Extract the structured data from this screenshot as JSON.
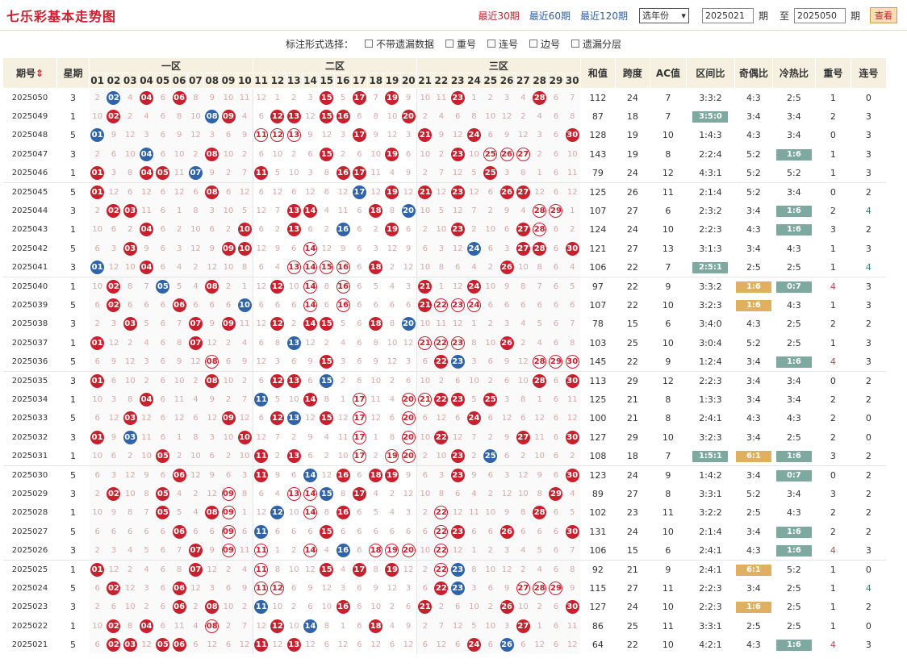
{
  "title": "七乐彩基本走势图",
  "periods": [
    "最近30期",
    "最近60期",
    "最近120期"
  ],
  "year_select": "选年份",
  "from_value": "2025021",
  "from_unit": "期",
  "to_label": "至",
  "to_value": "2025050",
  "to_unit": "期",
  "query_btn": "查看",
  "options_label": "标注形式选择：",
  "options": [
    "不带遗漏数据",
    "重号",
    "连号",
    "边号",
    "遗漏分层"
  ],
  "headers": {
    "period": "期号",
    "week": "星期",
    "zone1": "一区",
    "zone2": "二区",
    "zone3": "三区",
    "sum": "和值",
    "span": "跨度",
    "ac": "AC值",
    "zone_ratio": "区间比",
    "odd_even": "奇偶比",
    "hot_cold": "冷热比",
    "repeat": "重号",
    "consec": "连号"
  },
  "nums": [
    "01",
    "02",
    "03",
    "04",
    "05",
    "06",
    "07",
    "08",
    "09",
    "10",
    "11",
    "12",
    "13",
    "14",
    "15",
    "16",
    "17",
    "18",
    "19",
    "20",
    "21",
    "22",
    "23",
    "24",
    "25",
    "26",
    "27",
    "28",
    "29",
    "30"
  ],
  "rows": [
    {
      "p": "2025050",
      "w": "3",
      "r": [
        4,
        6,
        15,
        17,
        19,
        23,
        28
      ],
      "b": [
        2
      ],
      "sum": "112",
      "span": "24",
      "ac": "7",
      "zr": "3:3:2",
      "oe": "4:3",
      "hc": "2:5",
      "rep": "1",
      "con": "0"
    },
    {
      "p": "2025049",
      "w": "1",
      "r": [
        2,
        9,
        12,
        13,
        15,
        16,
        20
      ],
      "b": [
        8
      ],
      "sum": "87",
      "span": "18",
      "ac": "7",
      "zr": "3:5:0",
      "zrT": "g",
      "oe": "3:4",
      "hc": "3:4",
      "rep": "2",
      "con": "3"
    },
    {
      "p": "2025048",
      "w": "5",
      "r": [
        17,
        21,
        24,
        30
      ],
      "b": [
        1
      ],
      "o": [
        11,
        12,
        13
      ],
      "sum": "128",
      "span": "19",
      "ac": "10",
      "zr": "1:4:3",
      "oe": "4:3",
      "hc": "3:4",
      "rep": "0",
      "con": "3"
    },
    {
      "p": "2025047",
      "w": "3",
      "r": [
        8,
        15,
        19,
        23
      ],
      "b": [
        4
      ],
      "o": [
        25,
        26,
        27
      ],
      "sum": "143",
      "span": "19",
      "ac": "8",
      "zr": "2:2:4",
      "oe": "5:2",
      "hc": "1:6",
      "hcT": "g",
      "rep": "1",
      "con": "3"
    },
    {
      "p": "2025046",
      "w": "1",
      "r": [
        1,
        4,
        5,
        11,
        16,
        17,
        25
      ],
      "b": [
        7
      ],
      "sum": "79",
      "span": "24",
      "ac": "12",
      "zr": "4:3:1",
      "oe": "5:2",
      "hc": "5:2",
      "rep": "1",
      "con": "3"
    },
    {
      "p": "2025045",
      "w": "5",
      "r": [
        1,
        8,
        19,
        21,
        23,
        26,
        27
      ],
      "b": [
        17
      ],
      "sum": "125",
      "span": "26",
      "ac": "11",
      "zr": "2:1:4",
      "oe": "5:2",
      "hc": "3:4",
      "rep": "0",
      "con": "2"
    },
    {
      "p": "2025044",
      "w": "3",
      "r": [
        2,
        3,
        13,
        14,
        18
      ],
      "b": [
        20
      ],
      "o": [
        28,
        29
      ],
      "sum": "107",
      "span": "27",
      "ac": "6",
      "zr": "2:3:2",
      "oe": "3:4",
      "hc": "1:6",
      "hcT": "g",
      "rep": "2",
      "con": "4",
      "conC": 1
    },
    {
      "p": "2025043",
      "w": "1",
      "r": [
        4,
        10,
        13,
        19,
        23,
        27
      ],
      "b": [
        16
      ],
      "o": [
        28
      ],
      "sum": "124",
      "span": "24",
      "ac": "10",
      "zr": "2:2:3",
      "oe": "4:3",
      "hc": "1:6",
      "hcT": "g",
      "rep": "3",
      "con": "2"
    },
    {
      "p": "2025042",
      "w": "5",
      "r": [
        3,
        9,
        10,
        27,
        28,
        30
      ],
      "b": [
        24
      ],
      "o": [
        14
      ],
      "sum": "121",
      "span": "27",
      "ac": "13",
      "zr": "3:1:3",
      "oe": "3:4",
      "hc": "4:3",
      "rep": "1",
      "con": "3"
    },
    {
      "p": "2025041",
      "w": "3",
      "r": [
        4,
        18,
        26
      ],
      "b": [
        1
      ],
      "o": [
        13,
        14,
        15,
        16
      ],
      "sum": "106",
      "span": "22",
      "ac": "7",
      "zr": "2:5:1",
      "zrT": "g",
      "oe": "2:5",
      "hc": "2:5",
      "rep": "1",
      "con": "4",
      "conC": 1
    },
    {
      "p": "2025040",
      "w": "1",
      "r": [
        2,
        8,
        12,
        21,
        24
      ],
      "b": [
        5
      ],
      "o": [
        14,
        16
      ],
      "sum": "97",
      "span": "22",
      "ac": "9",
      "zr": "3:3:2",
      "oe": "1:6",
      "oeT": "y",
      "hc": "0:7",
      "hcT": "g",
      "rep": "4",
      "repC": 1,
      "con": "3"
    },
    {
      "p": "2025039",
      "w": "5",
      "r": [
        2,
        6,
        21
      ],
      "b": [
        10
      ],
      "o": [
        14,
        16,
        22,
        23,
        24
      ],
      "sum": "107",
      "span": "22",
      "ac": "10",
      "zr": "3:2:3",
      "oe": "1:6",
      "oeT": "y",
      "hc": "4:3",
      "rep": "1",
      "con": "3"
    },
    {
      "p": "2025038",
      "w": "3",
      "r": [
        3,
        7,
        9,
        12,
        14,
        15,
        18
      ],
      "b": [
        20
      ],
      "sum": "78",
      "span": "15",
      "ac": "6",
      "zr": "3:4:0",
      "oe": "4:3",
      "hc": "2:5",
      "rep": "2",
      "con": "2"
    },
    {
      "p": "2025037",
      "w": "1",
      "r": [
        1,
        7,
        26
      ],
      "b": [
        13
      ],
      "o": [
        21,
        22,
        23
      ],
      "sum": "103",
      "span": "25",
      "ac": "10",
      "zr": "3:0:4",
      "oe": "5:2",
      "hc": "2:5",
      "rep": "1",
      "con": "3"
    },
    {
      "p": "2025036",
      "w": "5",
      "r": [
        15,
        22
      ],
      "b": [
        23
      ],
      "o": [
        8,
        28,
        29,
        30
      ],
      "sum": "145",
      "span": "22",
      "ac": "9",
      "zr": "1:2:4",
      "oe": "3:4",
      "hc": "1:6",
      "hcT": "g",
      "rep": "4",
      "repC": 1,
      "con": "3"
    },
    {
      "p": "2025035",
      "w": "3",
      "r": [
        1,
        8,
        12,
        13,
        28,
        30
      ],
      "b": [
        15
      ],
      "sum": "113",
      "span": "29",
      "ac": "12",
      "zr": "2:2:3",
      "oe": "3:4",
      "hc": "3:4",
      "rep": "0",
      "con": "2"
    },
    {
      "p": "2025034",
      "w": "1",
      "r": [
        4,
        14,
        22,
        23,
        25
      ],
      "b": [
        11
      ],
      "o": [
        17,
        20,
        21
      ],
      "sum": "125",
      "span": "21",
      "ac": "8",
      "zr": "1:3:3",
      "oe": "3:4",
      "hc": "3:4",
      "rep": "2",
      "con": "2"
    },
    {
      "p": "2025033",
      "w": "5",
      "r": [
        3,
        9,
        12,
        15,
        24
      ],
      "b": [
        13
      ],
      "o": [
        17,
        20
      ],
      "sum": "100",
      "span": "21",
      "ac": "8",
      "zr": "2:4:1",
      "oe": "4:3",
      "hc": "4:3",
      "rep": "2",
      "con": "0"
    },
    {
      "p": "2025032",
      "w": "3",
      "r": [
        1,
        10,
        22,
        27,
        30
      ],
      "b": [
        3
      ],
      "o": [
        17,
        20
      ],
      "sum": "127",
      "span": "29",
      "ac": "10",
      "zr": "3:2:3",
      "oe": "3:4",
      "hc": "2:5",
      "rep": "2",
      "con": "0"
    },
    {
      "p": "2025031",
      "w": "1",
      "r": [
        5,
        11,
        13,
        23
      ],
      "b": [
        25
      ],
      "o": [
        17,
        19,
        20
      ],
      "sum": "108",
      "span": "18",
      "ac": "7",
      "zr": "1:5:1",
      "zrT": "g",
      "oe": "6:1",
      "oeT": "y",
      "hc": "1:6",
      "hcT": "g",
      "rep": "3",
      "con": "2"
    },
    {
      "p": "2025030",
      "w": "5",
      "r": [
        6,
        11,
        16,
        18,
        19,
        23,
        30
      ],
      "b": [
        14
      ],
      "sum": "123",
      "span": "24",
      "ac": "9",
      "zr": "1:4:2",
      "oe": "3:4",
      "hc": "0:7",
      "hcT": "g",
      "rep": "0",
      "con": "2"
    },
    {
      "p": "2025029",
      "w": "3",
      "r": [
        2,
        5,
        17,
        29
      ],
      "b": [
        15
      ],
      "o": [
        9,
        13,
        14
      ],
      "sum": "89",
      "span": "27",
      "ac": "8",
      "zr": "3:3:1",
      "oe": "5:2",
      "hc": "3:4",
      "rep": "3",
      "con": "2"
    },
    {
      "p": "2025028",
      "w": "1",
      "r": [
        5,
        8,
        16,
        28
      ],
      "b": [
        12
      ],
      "o": [
        9,
        14,
        22
      ],
      "sum": "102",
      "span": "23",
      "ac": "11",
      "zr": "3:2:2",
      "oe": "2:5",
      "hc": "4:3",
      "rep": "2",
      "con": "2"
    },
    {
      "p": "2025027",
      "w": "5",
      "r": [
        6,
        15,
        23,
        26,
        30
      ],
      "b": [
        11
      ],
      "o": [
        9,
        22
      ],
      "sum": "131",
      "span": "24",
      "ac": "10",
      "zr": "2:1:4",
      "oe": "3:4",
      "hc": "1:6",
      "hcT": "g",
      "rep": "2",
      "con": "2"
    },
    {
      "p": "2025026",
      "w": "3",
      "r": [
        7
      ],
      "b": [
        16
      ],
      "o": [
        9,
        14,
        11,
        18,
        19,
        20,
        22
      ],
      "sum": "106",
      "span": "15",
      "ac": "6",
      "zr": "2:4:1",
      "oe": "4:3",
      "hc": "1:6",
      "hcT": "g",
      "rep": "4",
      "repC": 1,
      "con": "3"
    },
    {
      "p": "2025025",
      "w": "1",
      "r": [
        1,
        7,
        15,
        17,
        19
      ],
      "b": [
        23
      ],
      "o": [
        11,
        22
      ],
      "sum": "92",
      "span": "21",
      "ac": "9",
      "zr": "2:4:1",
      "oe": "6:1",
      "oeT": "y",
      "hc": "5:2",
      "rep": "1",
      "con": "0"
    },
    {
      "p": "2025024",
      "w": "5",
      "r": [
        2,
        6,
        22
      ],
      "b": [
        23
      ],
      "o": [
        11,
        12,
        27,
        28,
        29
      ],
      "sum": "115",
      "span": "27",
      "ac": "11",
      "zr": "2:2:3",
      "oe": "3:4",
      "hc": "2:5",
      "rep": "1",
      "con": "4",
      "conC": 1
    },
    {
      "p": "2025023",
      "w": "3",
      "r": [
        6,
        8,
        16,
        21,
        26,
        30
      ],
      "b": [
        11
      ],
      "sum": "127",
      "span": "24",
      "ac": "10",
      "zr": "2:2:3",
      "oe": "1:6",
      "oeT": "y",
      "hc": "2:5",
      "rep": "1",
      "con": "2"
    },
    {
      "p": "2025022",
      "w": "1",
      "r": [
        2,
        4,
        12,
        18,
        27
      ],
      "b": [
        14
      ],
      "o": [
        8
      ],
      "sum": "86",
      "span": "25",
      "ac": "11",
      "zr": "3:3:1",
      "oe": "2:5",
      "hc": "2:5",
      "rep": "1",
      "con": "0"
    },
    {
      "p": "2025021",
      "w": "5",
      "r": [
        2,
        3,
        5,
        6,
        11,
        13,
        24
      ],
      "b": [
        26
      ],
      "sum": "64",
      "span": "22",
      "ac": "10",
      "zr": "4:2:1",
      "oe": "4:3",
      "hc": "1:6",
      "hcT": "g",
      "rep": "4",
      "repC": 1,
      "con": "3"
    }
  ]
}
